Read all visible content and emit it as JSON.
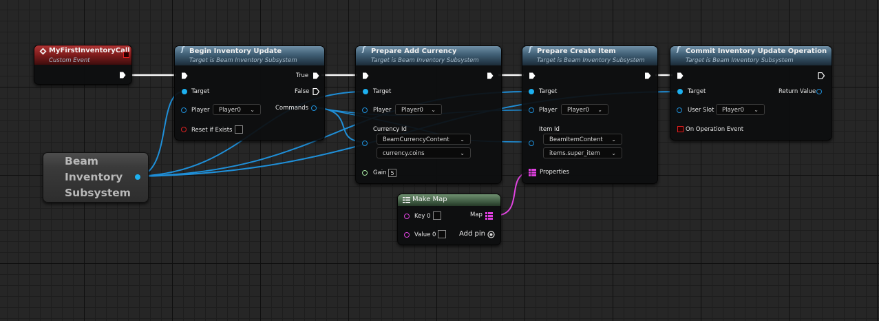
{
  "colors": {
    "exec_wire": "#ffffff",
    "object_wire": "#1f8fd8",
    "map_wire": "#e044e0",
    "function_header": "#4f6f87",
    "event_header": "#8a1f1f",
    "make_map_header": "#4e6c52"
  },
  "nodes": {
    "event": {
      "title": "MyFirstInventoryCall",
      "subtitle": "Custom Event",
      "icon": "event-diamond-icon"
    },
    "beam_subsystem": {
      "line1": "Beam",
      "line2": "Inventory",
      "line3": "Subsystem"
    },
    "begin_update": {
      "title": "Begin Inventory Update",
      "subtitle": "Target is Beam Inventory Subsystem",
      "icon": "function-icon",
      "target": "Target",
      "player": "Player",
      "player_value": "Player0",
      "reset": "Reset if Exists",
      "true_label": "True",
      "false_label": "False",
      "commands": "Commands"
    },
    "add_currency": {
      "title": "Prepare Add Currency",
      "subtitle": "Target is Beam Inventory Subsystem",
      "icon": "function-icon",
      "target": "Target",
      "player": "Player",
      "player_value": "Player0",
      "currency_id": "Currency Id",
      "currency_content": "BeamCurrencyContent",
      "currency_value": "currency.coins",
      "gain": "Gain",
      "gain_value": "5"
    },
    "create_item": {
      "title": "Prepare Create Item",
      "subtitle": "Target is Beam Inventory Subsystem",
      "icon": "function-icon",
      "target": "Target",
      "player": "Player",
      "player_value": "Player0",
      "item_id": "Item Id",
      "item_content": "BeamItemContent",
      "item_value": "items.super_item",
      "properties": "Properties"
    },
    "commit_update": {
      "title": "Commit Inventory Update Operation",
      "subtitle": "Target is Beam Inventory Subsystem",
      "icon": "function-icon",
      "target": "Target",
      "user_slot": "User Slot",
      "user_slot_value": "Player0",
      "on_event": "On Operation Event",
      "return_value": "Return Value"
    },
    "make_map": {
      "title": "Make Map",
      "icon": "make-map-icon",
      "key": "Key 0",
      "value": "Value 0",
      "map": "Map",
      "add_pin": "Add pin"
    }
  }
}
